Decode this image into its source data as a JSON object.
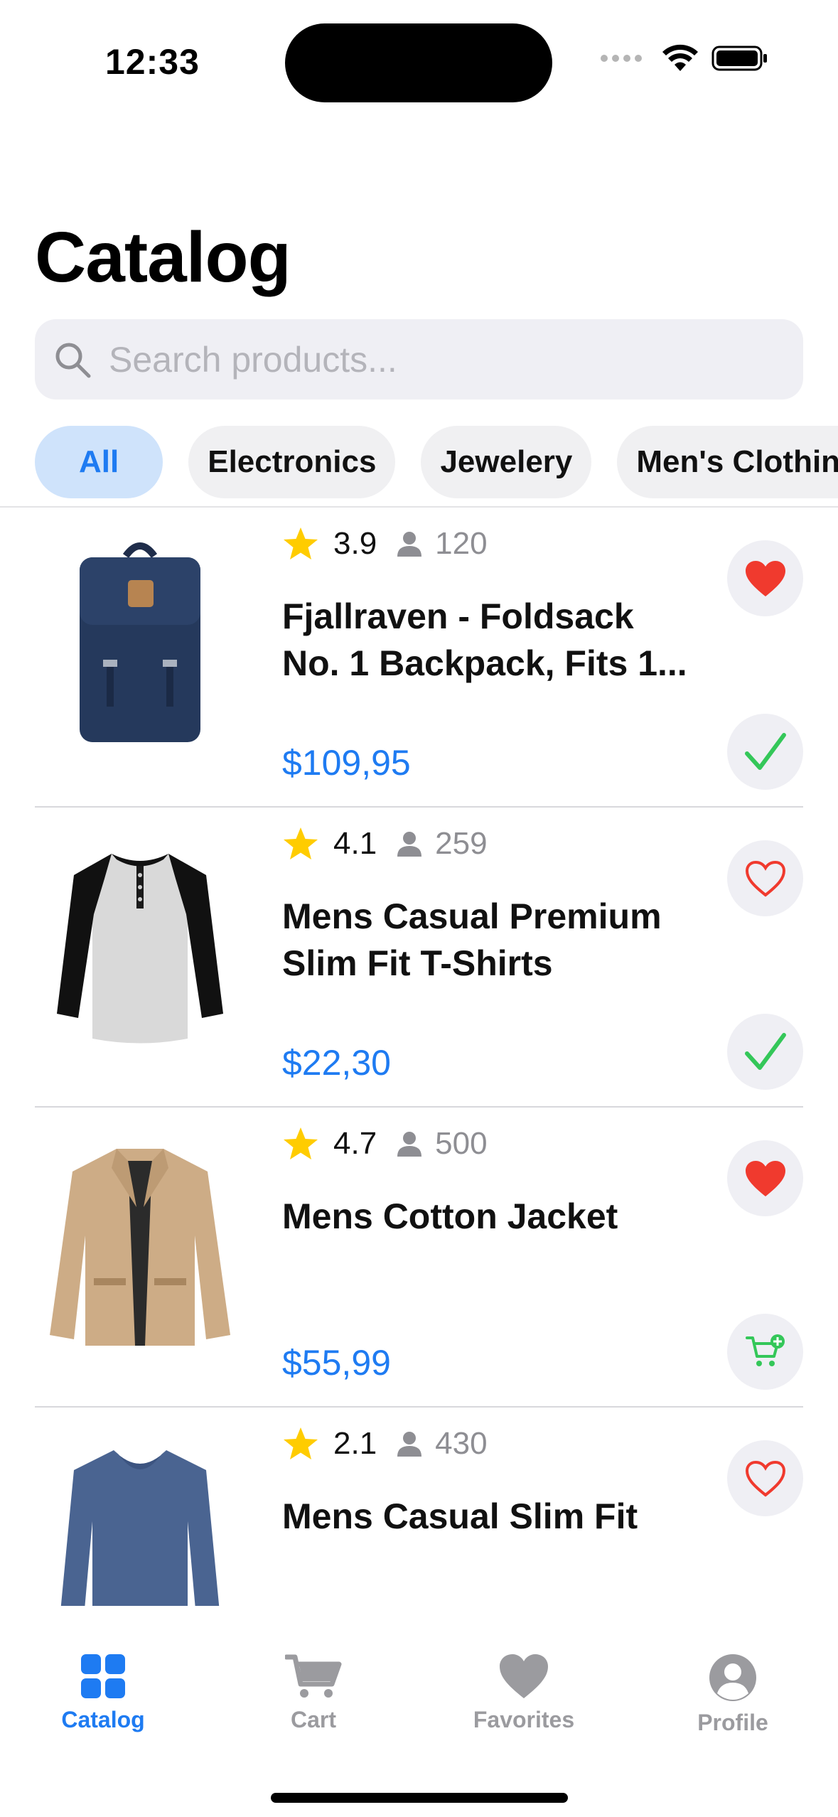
{
  "status_bar": {
    "time": "12:33"
  },
  "header": {
    "title": "Catalog"
  },
  "search": {
    "placeholder": "Search products..."
  },
  "categories": [
    {
      "label": "All",
      "active": true
    },
    {
      "label": "Electronics",
      "active": false
    },
    {
      "label": "Jewelery",
      "active": false
    },
    {
      "label": "Men's Clothing",
      "active": false
    }
  ],
  "products": [
    {
      "rating": "3.9",
      "reviews": "120",
      "name_line1": "Fjallraven - Foldsack",
      "name_line2": "No. 1 Backpack, Fits 1...",
      "price": "$109,95",
      "favorite": true,
      "action": "in-cart"
    },
    {
      "rating": "4.1",
      "reviews": "259",
      "name_line1": "Mens Casual Premium",
      "name_line2": "Slim Fit T-Shirts",
      "price": "$22,30",
      "favorite": false,
      "action": "in-cart"
    },
    {
      "rating": "4.7",
      "reviews": "500",
      "name_line1": "Mens Cotton Jacket",
      "name_line2": "",
      "price": "$55,99",
      "favorite": true,
      "action": "add-to-cart"
    },
    {
      "rating": "2.1",
      "reviews": "430",
      "name_line1": "Mens Casual Slim Fit",
      "name_line2": "",
      "price": "",
      "favorite": false,
      "action": "none"
    }
  ],
  "tabs": [
    {
      "label": "Catalog",
      "icon": "grid-icon",
      "active": true
    },
    {
      "label": "Cart",
      "icon": "cart-icon",
      "active": false
    },
    {
      "label": "Favorites",
      "icon": "heart-icon",
      "active": false
    },
    {
      "label": "Profile",
      "icon": "person-icon",
      "active": false
    }
  ],
  "colors": {
    "accent": "#1e7bf2",
    "favorite": "#f03a2e",
    "check": "#34c759",
    "star": "#ffcc00"
  }
}
